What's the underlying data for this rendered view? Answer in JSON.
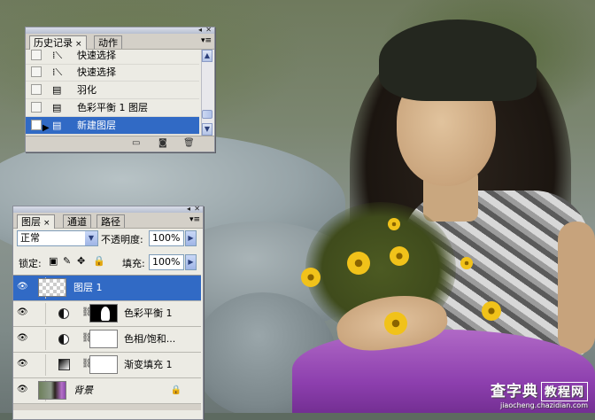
{
  "history_panel": {
    "tabs": [
      {
        "label": "历史记录",
        "active": true
      },
      {
        "label": "动作",
        "active": false
      }
    ],
    "close_symbol": "×",
    "menu_icon": "panel-menu-icon",
    "items": [
      {
        "label": "快速选择",
        "icon": "quick-select-icon",
        "selected": false
      },
      {
        "label": "快速选择",
        "icon": "quick-select-icon",
        "selected": false
      },
      {
        "label": "羽化",
        "icon": "history-state-icon",
        "selected": false
      },
      {
        "label": "色彩平衡 1 图层",
        "icon": "history-state-icon",
        "selected": false
      },
      {
        "label": "新建图层",
        "icon": "history-state-icon",
        "selected": true
      }
    ],
    "footer_icons": [
      "new-document-from-state-icon",
      "snapshot-icon",
      "trash-icon"
    ]
  },
  "layers_panel": {
    "tabs": [
      {
        "label": "图层",
        "active": true
      },
      {
        "label": "通道",
        "active": false
      },
      {
        "label": "路径",
        "active": false
      }
    ],
    "close_symbol": "×",
    "blend_mode": "正常",
    "opacity_label": "不透明度:",
    "opacity_value": "100%",
    "lock_label": "锁定:",
    "fill_label": "填充:",
    "fill_value": "100%",
    "layers": [
      {
        "name": "图层 1",
        "type": "pixel",
        "selected": true,
        "visible": true
      },
      {
        "name": "色彩平衡 1",
        "type": "adjustment",
        "selected": false,
        "visible": true
      },
      {
        "name": "色相/饱和...",
        "type": "adjustment",
        "selected": false,
        "visible": true
      },
      {
        "name": "渐变填充 1",
        "type": "gradient",
        "selected": false,
        "visible": true
      },
      {
        "name": "背景",
        "type": "background",
        "selected": false,
        "visible": true,
        "locked": true
      }
    ]
  },
  "watermark": {
    "main": "查字典",
    "box": "教程网",
    "url": "jiaocheng.chazidian.com"
  },
  "colors": {
    "selection": "#316ac5",
    "panel_bg": "#ecebe4",
    "tab_bg": "#d4d0c8"
  }
}
